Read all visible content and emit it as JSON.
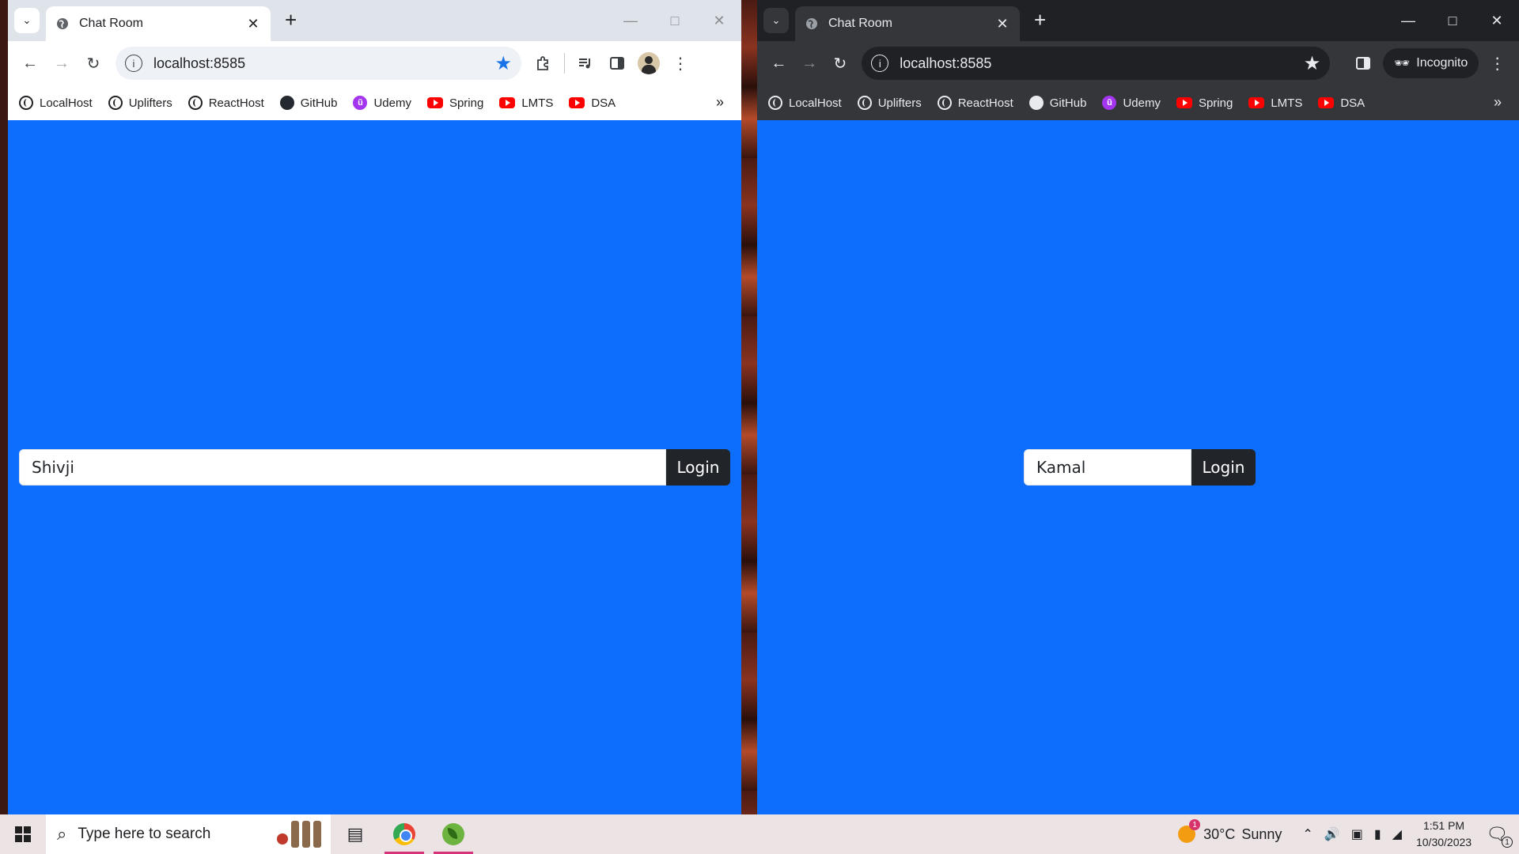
{
  "left_window": {
    "tab": {
      "title": "Chat Room"
    },
    "address": {
      "url": "localhost:8585"
    },
    "bookmarks": [
      {
        "label": "LocalHost",
        "icon": "globe-icon"
      },
      {
        "label": "Uplifters",
        "icon": "globe-icon"
      },
      {
        "label": "ReactHost",
        "icon": "globe-icon"
      },
      {
        "label": "GitHub",
        "icon": "github-icon"
      },
      {
        "label": "Udemy",
        "icon": "udemy-icon"
      },
      {
        "label": "Spring",
        "icon": "youtube-icon"
      },
      {
        "label": "LMTS",
        "icon": "youtube-icon"
      },
      {
        "label": "DSA",
        "icon": "youtube-icon"
      }
    ],
    "login": {
      "username_value": "Shivji",
      "button_label": "Login"
    }
  },
  "right_window": {
    "tab": {
      "title": "Chat Room"
    },
    "address": {
      "url": "localhost:8585"
    },
    "incognito_label": "Incognito",
    "bookmarks": [
      {
        "label": "LocalHost",
        "icon": "globe-icon"
      },
      {
        "label": "Uplifters",
        "icon": "globe-icon"
      },
      {
        "label": "ReactHost",
        "icon": "globe-icon"
      },
      {
        "label": "GitHub",
        "icon": "github-icon"
      },
      {
        "label": "Udemy",
        "icon": "udemy-icon"
      },
      {
        "label": "Spring",
        "icon": "youtube-icon"
      },
      {
        "label": "LMTS",
        "icon": "youtube-icon"
      },
      {
        "label": "DSA",
        "icon": "youtube-icon"
      }
    ],
    "login": {
      "username_value": "Kamal",
      "button_label": "Login"
    }
  },
  "colors": {
    "page_background": "#0d6efd",
    "login_button": "#212529"
  },
  "taskbar": {
    "search_placeholder": "Type here to search",
    "weather": {
      "temperature": "30°C",
      "condition": "Sunny",
      "badge": "1"
    },
    "clock": {
      "time": "1:51 PM",
      "date": "10/30/2023"
    },
    "notifications_count": "1"
  }
}
